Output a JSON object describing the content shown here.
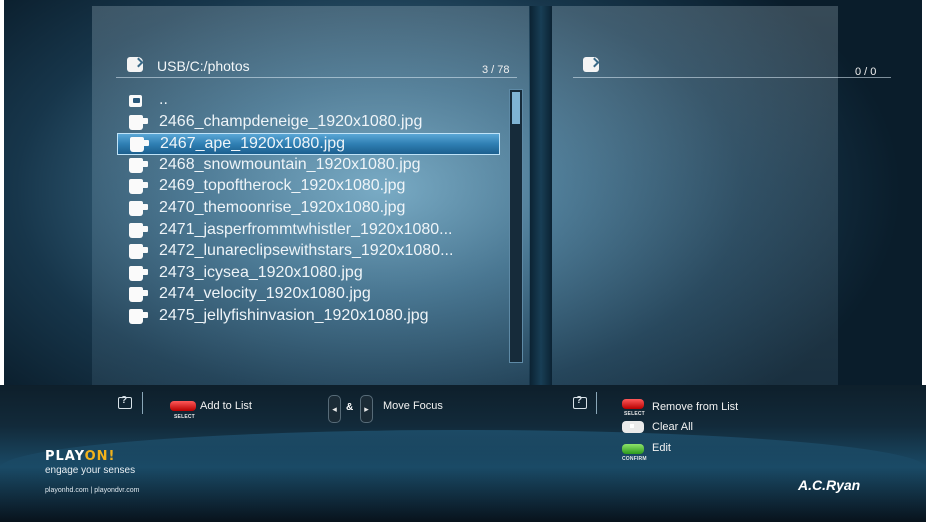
{
  "left_panel": {
    "path": "USB/C:/photos",
    "count": "3 / 78",
    "files": [
      {
        "name": "..",
        "type": "folder-up"
      },
      {
        "name": "2466_champdeneige_1920x1080.jpg",
        "type": "photo"
      },
      {
        "name": "2467_ape_1920x1080.jpg",
        "type": "photo",
        "selected": true
      },
      {
        "name": "2468_snowmountain_1920x1080.jpg",
        "type": "photo"
      },
      {
        "name": "2469_topoftherock_1920x1080.jpg",
        "type": "photo"
      },
      {
        "name": "2470_themoonrise_1920x1080.jpg",
        "type": "photo"
      },
      {
        "name": "2471_jasperfrommtwhistler_1920x1080...",
        "type": "photo"
      },
      {
        "name": "2472_lunareclipsewithstars_1920x1080...",
        "type": "photo"
      },
      {
        "name": "2473_icysea_1920x1080.jpg",
        "type": "photo"
      },
      {
        "name": "2474_velocity_1920x1080.jpg",
        "type": "photo"
      },
      {
        "name": "2475_jellyfishinvasion_1920x1080.jpg",
        "type": "photo"
      }
    ]
  },
  "right_panel": {
    "count": "0 / 0"
  },
  "legend_left": {
    "add_to_list": "Add to List",
    "select_key": "SELECT",
    "amp": "&",
    "move_focus": "Move Focus",
    "nav_left": "◂",
    "nav_right": "▸"
  },
  "legend_right": {
    "remove_from_list": "Remove from List",
    "select_key": "SELECT",
    "clear_all": "Clear All",
    "edit": "Edit",
    "confirm_key": "CONFIRM"
  },
  "branding": {
    "logo_play": "PLAY",
    "logo_on": "ON!",
    "tagline": "engage your senses",
    "website": "playonhd.com | playondvr.com",
    "brand": "A.C.Ryan"
  },
  "colors": {
    "selection": "#2f7fb3",
    "red_key": "#d40000",
    "green_key": "#4cc02a",
    "logo_accent": "#f1b21b"
  }
}
